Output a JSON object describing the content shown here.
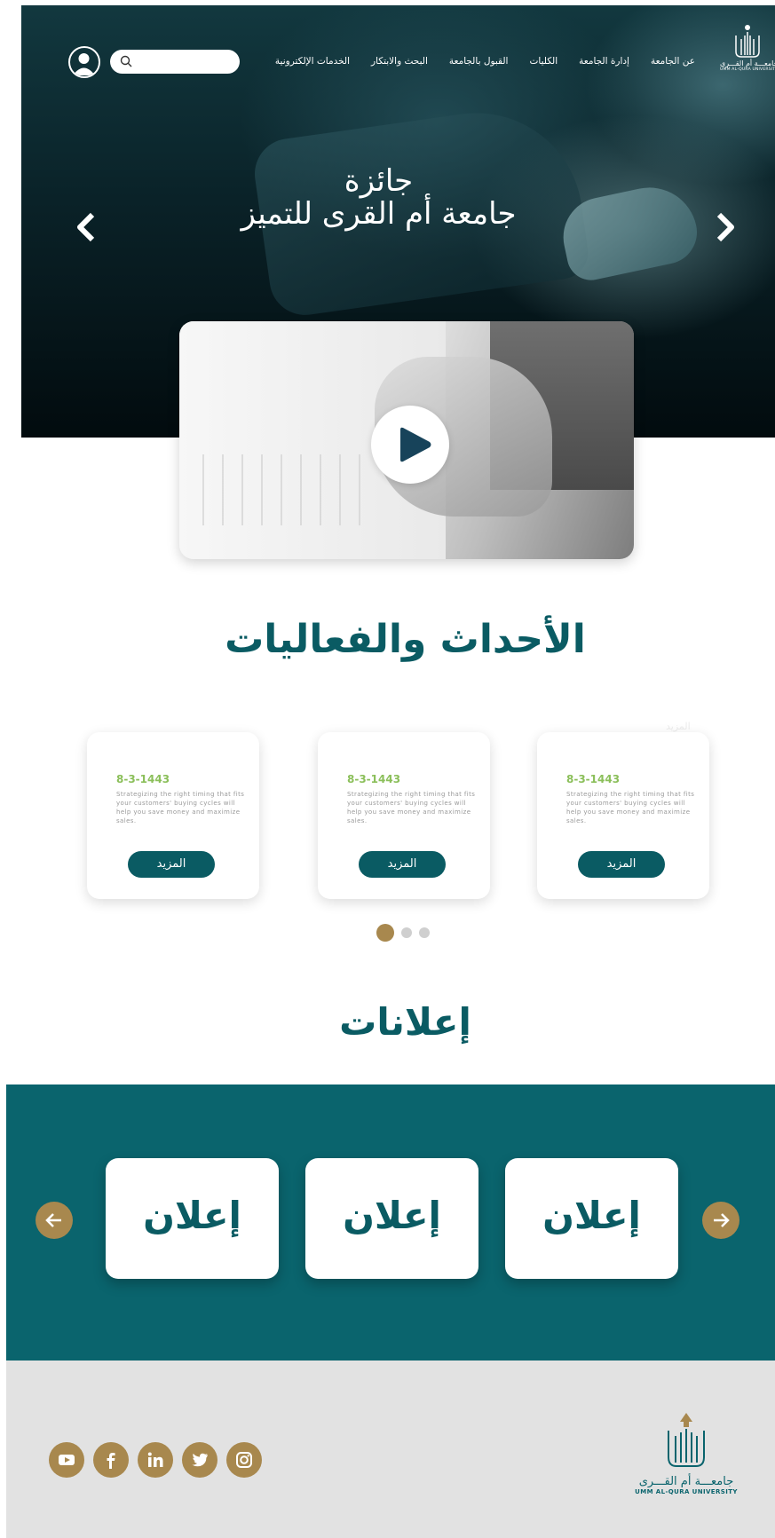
{
  "header": {
    "logo": {
      "arabic": "جامعـــة أم القـــرى",
      "english": "UMM AL-QURA UNIVERSITY",
      "icon": "university-emblem-icon"
    },
    "nav": [
      {
        "label": "عن الجامعة"
      },
      {
        "label": "إدارة الجامعة"
      },
      {
        "label": "الكليات"
      },
      {
        "label": "القبول بالجامعة"
      },
      {
        "label": "البحث والابتكار"
      },
      {
        "label": "الخدمات الإلكترونية"
      }
    ],
    "search": {
      "placeholder": "",
      "icon": "search-icon"
    },
    "account_icon": "user-icon"
  },
  "hero": {
    "line1": "جائزة",
    "line2": "جامعة أم القرى للتميز",
    "prev_icon": "chevron-left-icon",
    "next_icon": "chevron-right-icon"
  },
  "video": {
    "play_icon": "play-icon"
  },
  "events": {
    "title": "الأحداث والفعاليات",
    "ghost": "المزيد",
    "cards": [
      {
        "date": "8-3-1443",
        "desc": "Strategizing the right timing that fits your customers' buying cycles will help you save money and maximize sales.",
        "button": "المزيد"
      },
      {
        "date": "8-3-1443",
        "desc": "Strategizing the right timing that fits your customers' buying cycles will help you save money and maximize sales.",
        "button": "المزيد"
      },
      {
        "date": "8-3-1443",
        "desc": "Strategizing the right timing that fits your customers' buying cycles will help you save money and maximize sales.",
        "button": "المزيد"
      }
    ],
    "pagination": {
      "total": 3,
      "active": 0
    }
  },
  "announcements": {
    "title": "إعلانات",
    "cards": [
      {
        "label": "إعلان"
      },
      {
        "label": "إعلان"
      },
      {
        "label": "إعلان"
      }
    ],
    "prev_icon": "arrow-left-icon",
    "next_icon": "arrow-right-icon"
  },
  "footer": {
    "socials": [
      "youtube-icon",
      "facebook-icon",
      "linkedin-icon",
      "twitter-icon",
      "instagram-icon"
    ],
    "logo": {
      "arabic": "جامعـــة أم القـــرى",
      "english": "UMM AL-QURA UNIVERSITY"
    }
  },
  "colors": {
    "primary": "#0a5b63",
    "band": "#0a646d",
    "gold": "#a8884e",
    "date_green": "#8bbf5a",
    "footer_bg": "#e2e2e2"
  }
}
